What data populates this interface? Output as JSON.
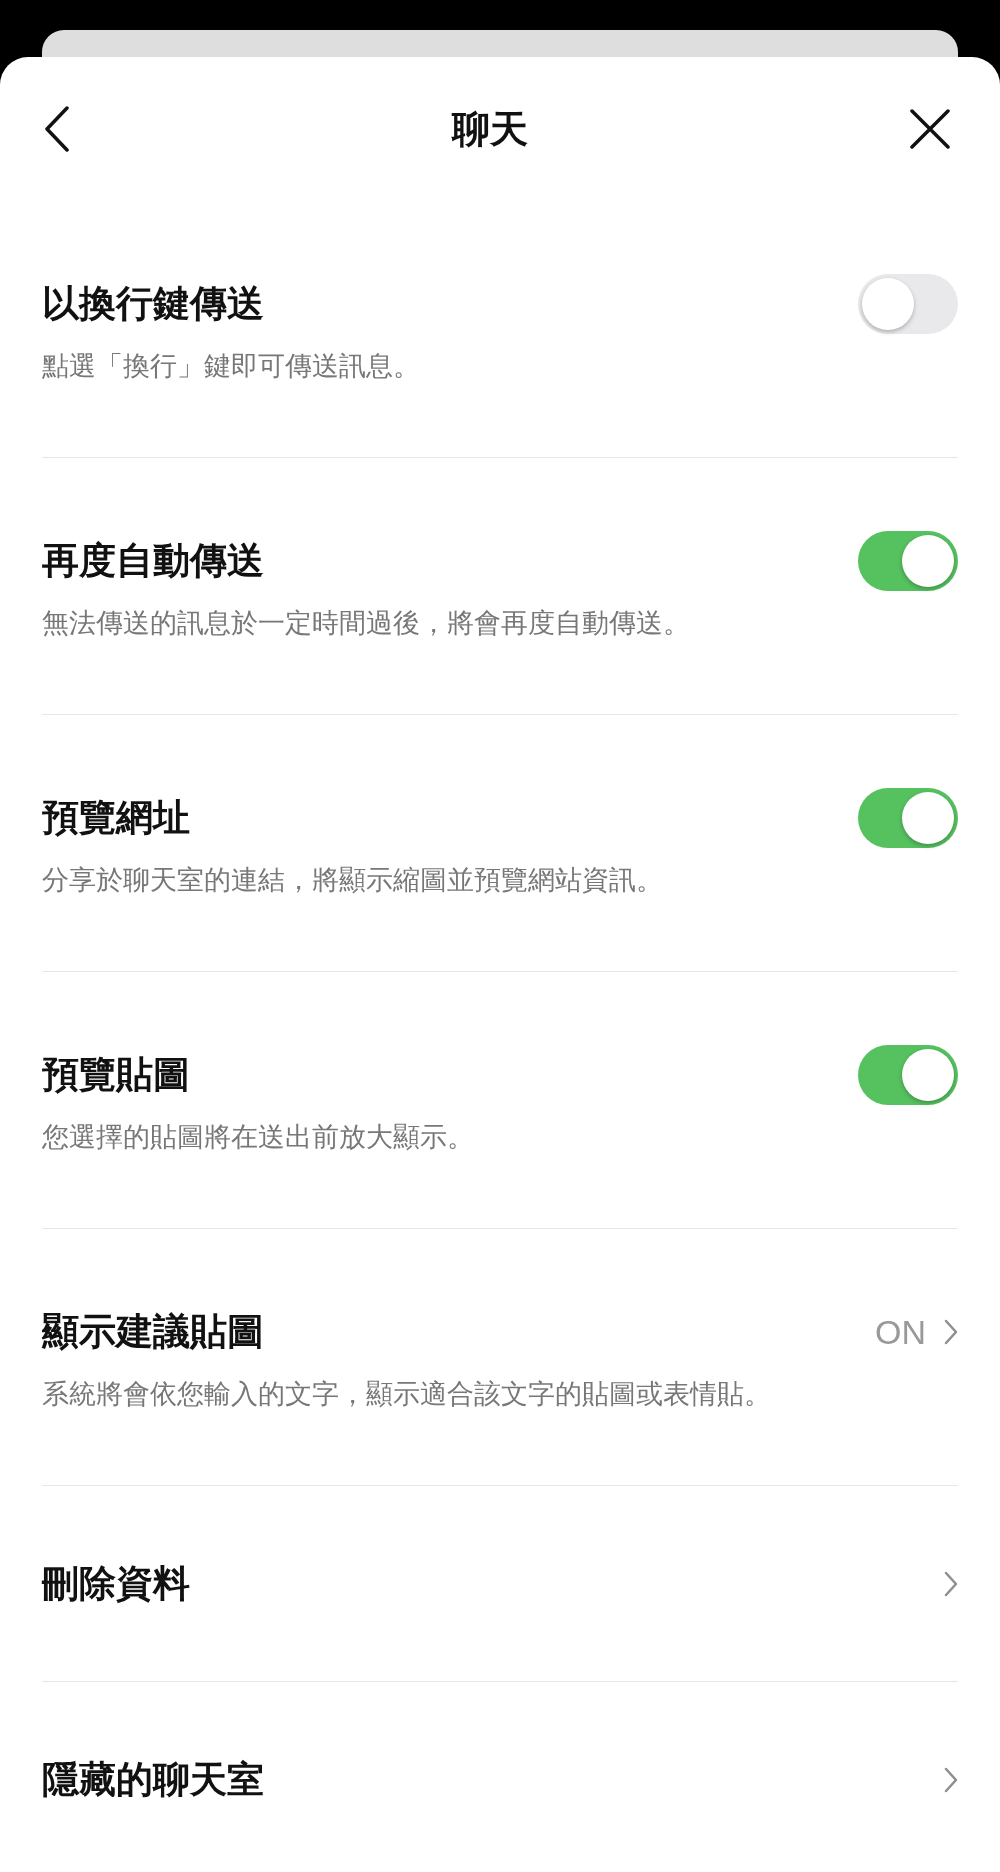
{
  "header": {
    "title": "聊天"
  },
  "settings": [
    {
      "kind": "toggle",
      "title": "以換行鍵傳送",
      "description": "點選「換行」鍵即可傳送訊息。",
      "on": false
    },
    {
      "kind": "toggle",
      "title": "再度自動傳送",
      "description": "無法傳送的訊息於一定時間過後，將會再度自動傳送。",
      "on": true
    },
    {
      "kind": "toggle",
      "title": "預覽網址",
      "description": "分享於聊天室的連結，將顯示縮圖並預覽網站資訊。",
      "on": true
    },
    {
      "kind": "toggle",
      "title": "預覽貼圖",
      "description": "您選擇的貼圖將在送出前放大顯示。",
      "on": true
    },
    {
      "kind": "link",
      "title": "顯示建議貼圖",
      "description": "系統將會依您輸入的文字，顯示適合該文字的貼圖或表情貼。",
      "value": "ON"
    },
    {
      "kind": "link",
      "title": "刪除資料"
    },
    {
      "kind": "link",
      "title": "隱藏的聊天室"
    }
  ]
}
